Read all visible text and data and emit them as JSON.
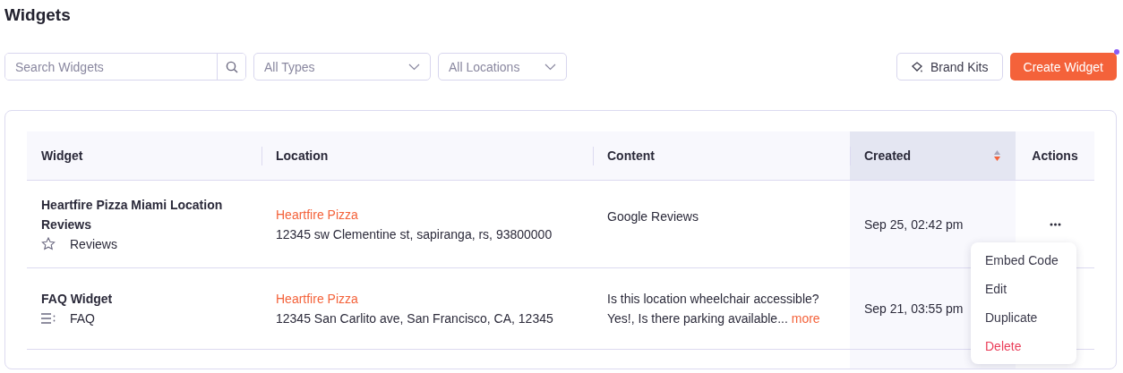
{
  "page_title": "Widgets",
  "filters": {
    "search_placeholder": "Search Widgets",
    "type_select": "All Types",
    "location_select": "All Locations"
  },
  "actions": {
    "brand_kits": "Brand Kits",
    "create": "Create Widget",
    "create_notification": true
  },
  "table": {
    "columns": [
      {
        "label": "Widget",
        "sorted": false
      },
      {
        "label": "Location",
        "sorted": false
      },
      {
        "label": "Content",
        "sorted": false
      },
      {
        "label": "Created",
        "sorted": true
      },
      {
        "label": "Actions",
        "sorted": false
      }
    ],
    "rows": [
      {
        "name": "Heartfire Pizza Miami Location Reviews",
        "kind": "reviews",
        "type_label": "Reviews",
        "location_name": "Heartfire Pizza",
        "address": "12345 sw Clementine st, sapiranga, rs, 93800000",
        "content": "Google Reviews",
        "created": "Sep 25, 02:42 pm",
        "menu_open": true
      },
      {
        "name": "FAQ Widget",
        "kind": "faq",
        "type_label": "FAQ",
        "location_name": "Heartfire Pizza",
        "address": "12345 San Carlito ave, San Francisco, CA, 12345",
        "content": "Is this location wheelchair accessible? Yes!, Is there parking available...",
        "more": "more",
        "created": "Sep 21, 03:55 pm",
        "menu_open": false
      }
    ]
  },
  "row_menu": [
    {
      "label": "Embed Code",
      "kind": "normal"
    },
    {
      "label": "Edit",
      "kind": "normal"
    },
    {
      "label": "Duplicate",
      "kind": "normal"
    },
    {
      "label": "Delete",
      "kind": "danger"
    }
  ]
}
